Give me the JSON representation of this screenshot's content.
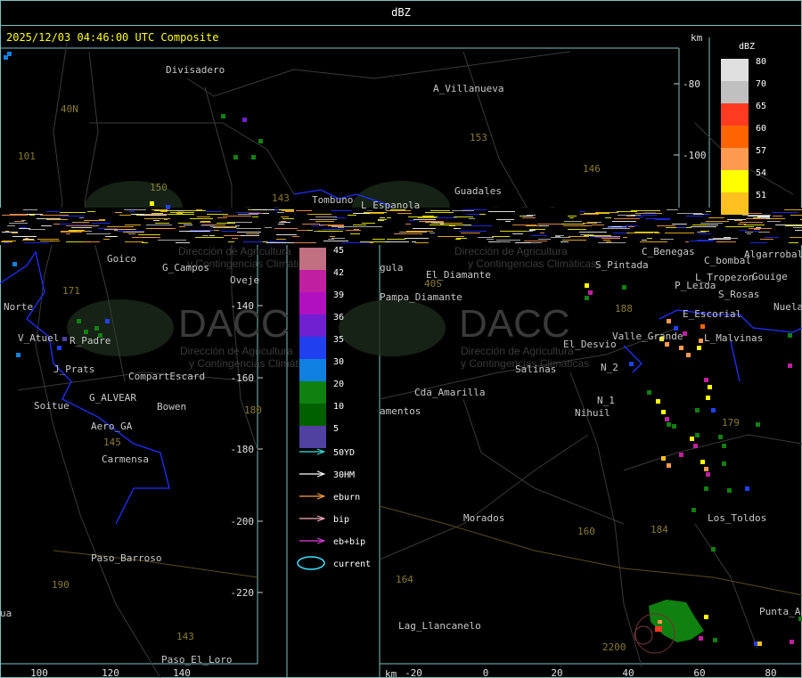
{
  "window": {
    "title": "dBZ"
  },
  "timestamp": "2025/12/03 04:46:00 UTC Composite",
  "units": {
    "km_top": "km",
    "km_bottom": "km"
  },
  "legend": {
    "title": "dBZ",
    "upper": [
      {
        "label": "80",
        "color": "#e0e0e0"
      },
      {
        "label": "70",
        "color": "#c0c0c0"
      },
      {
        "label": "65",
        "color": "#ff3a20"
      },
      {
        "label": "60",
        "color": "#ff6400"
      },
      {
        "label": "57",
        "color": "#ff9a50"
      },
      {
        "label": "54",
        "color": "#ffff00"
      },
      {
        "label": "51",
        "color": "#ffc020"
      }
    ],
    "lower": [
      {
        "label": "45",
        "color": "#c07080"
      },
      {
        "label": "42",
        "color": "#c020a0"
      },
      {
        "label": "39",
        "color": "#b010c0"
      },
      {
        "label": "36",
        "color": "#7020d0"
      },
      {
        "label": "35",
        "color": "#2040f0"
      },
      {
        "label": "30",
        "color": "#1080e0"
      },
      {
        "label": "20",
        "color": "#108010"
      },
      {
        "label": "10",
        "color": "#006000"
      },
      {
        "label": "5",
        "color": "#5040a0"
      }
    ],
    "tracks": [
      {
        "label": "50YD",
        "color": "#40e0e0"
      },
      {
        "label": "30HM",
        "color": "#ffffff"
      },
      {
        "label": "eburn",
        "color": "#ffa040"
      },
      {
        "label": "bip",
        "color": "#ffb0c0"
      },
      {
        "label": "eb+bip",
        "color": "#e040e0"
      },
      {
        "label": "current",
        "color": "#40e0ff"
      }
    ]
  },
  "axes": {
    "y_top": [
      "-80",
      "-100"
    ],
    "y_left": [
      "-140",
      "-160",
      "-180",
      "-200",
      "-220"
    ],
    "x_left": [
      "100",
      "120",
      "140"
    ],
    "x_right": [
      "-20",
      "0",
      "20",
      "40",
      "60",
      "80"
    ]
  },
  "places_top": [
    {
      "name": "Divisadero"
    },
    {
      "name": "A_Villanueva"
    },
    {
      "name": "Guadales"
    },
    {
      "name": "Tombuno"
    },
    {
      "name": "L_Espanola"
    }
  ],
  "places_left": [
    {
      "name": "Goico"
    },
    {
      "name": "G_Campos"
    },
    {
      "name": "Oveje"
    },
    {
      "name": "Norte"
    },
    {
      "name": "V_Atuel"
    },
    {
      "name": "R_Padre"
    },
    {
      "name": "J_Prats"
    },
    {
      "name": "CompartEscard"
    },
    {
      "name": "G_ALVEAR"
    },
    {
      "name": "Soitue"
    },
    {
      "name": "Bowen"
    },
    {
      "name": "Aero_GA"
    },
    {
      "name": "Carmensa"
    },
    {
      "name": "Paso_Barroso"
    },
    {
      "name": "Paso_El_Loro"
    },
    {
      "name": "ua"
    }
  ],
  "places_right": [
    {
      "name": "gula"
    },
    {
      "name": "Pampa_Diamante"
    },
    {
      "name": "El_Diamante"
    },
    {
      "name": "S_Pintada"
    },
    {
      "name": "C_Benegas"
    },
    {
      "name": "C_bombal"
    },
    {
      "name": "Algarrobal"
    },
    {
      "name": "L_Tropezon"
    },
    {
      "name": "Gouige"
    },
    {
      "name": "P_Leida"
    },
    {
      "name": "S_Rosas"
    },
    {
      "name": "Nuela"
    },
    {
      "name": "E_Escorial"
    },
    {
      "name": "Valle_Grande"
    },
    {
      "name": "L_Malvinas"
    },
    {
      "name": "El_Desvio"
    },
    {
      "name": "N_2"
    },
    {
      "name": "Salinas"
    },
    {
      "name": "N_1"
    },
    {
      "name": "Nihuil"
    },
    {
      "name": "Cda_Amarilla"
    },
    {
      "name": "amentos"
    },
    {
      "name": "Morados"
    },
    {
      "name": "Los_Toldos"
    },
    {
      "name": "Lag_Llancanelo"
    },
    {
      "name": "Punta_Ag"
    }
  ],
  "routes": [
    "40N",
    "101",
    "150",
    "153",
    "146",
    "143",
    "171",
    "188",
    "160",
    "184",
    "164",
    "179",
    "180",
    "145",
    "143",
    "190",
    "40S",
    "2200"
  ],
  "watermark": {
    "brand": "DACC",
    "sub1": "Dirección de Agricultura",
    "sub2": "y Contingencias Climáticas"
  },
  "colors": {
    "border": "#7fbfbf",
    "province": "#2030ff",
    "stamp": "#ffff00"
  }
}
